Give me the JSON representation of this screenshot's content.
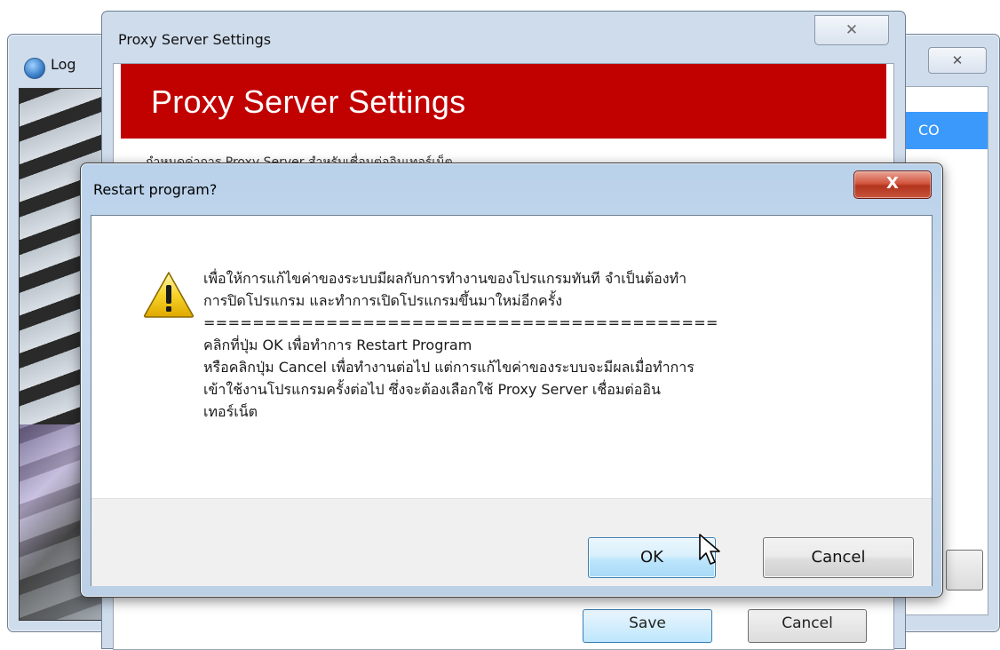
{
  "background_window": {
    "title": "Log",
    "close_symbol": "✕",
    "list_item": "CO"
  },
  "proxy_window": {
    "title": "Proxy Server Settings",
    "close_symbol": "✕",
    "banner_title": "Proxy Server Settings",
    "description": "กำหนดค่าการ Proxy Server สำหรับเชื่อมต่ออินเทอร์เน็ต",
    "save_label": "Save",
    "cancel_label": "Cancel",
    "banner_color": "#c10000"
  },
  "dialog": {
    "title": "Restart program?",
    "close_symbol": "X",
    "icon": "warning-icon",
    "message_lines": [
      "เพื่อให้การแก้ไขค่าของระบบมีผลกับการทำงานของโปรแกรมทันที จำเป็นต้องทำ",
      "การปิดโปรแกรม และทำการเปิดโปรแกรมขึ้นมาใหม่อีกครั้ง",
      "==========================================",
      "คลิกที่ปุ่ม OK เพื่อทำการ Restart Program",
      "หรือคลิกปุ่ม Cancel เพื่อทำงานต่อไป แต่การแก้ไขค่าของระบบจะมีผลเมื่อทำการ",
      "เข้าใช้งานโปรแกรมครั้งต่อไป ซึ่งจะต้องเลือกใช้ Proxy Server  เชื่อมต่ออิน",
      "เทอร์เน็ต"
    ],
    "ok_label": "OK",
    "cancel_label": "Cancel"
  }
}
